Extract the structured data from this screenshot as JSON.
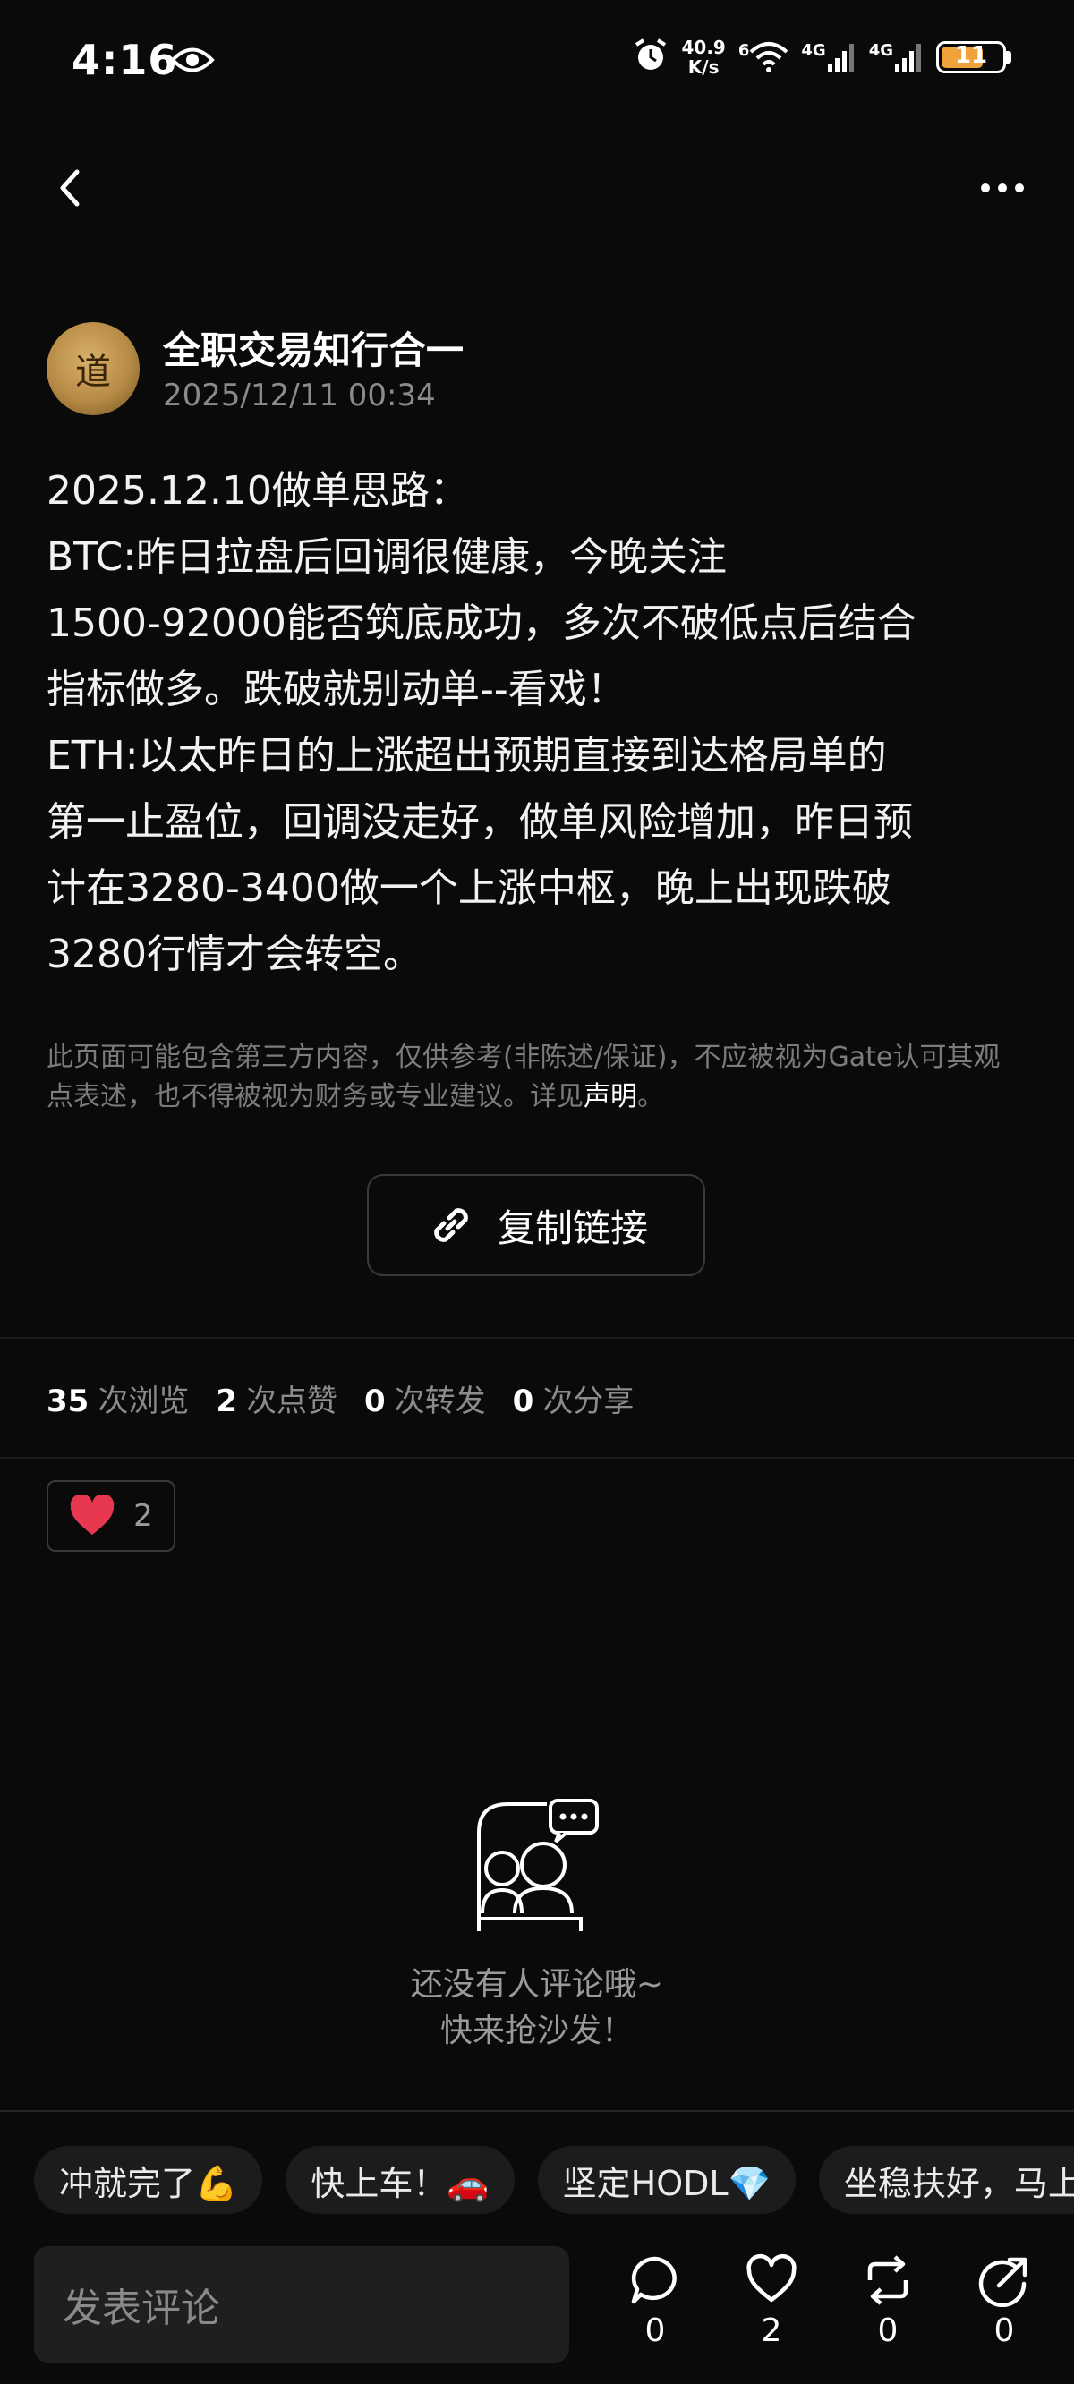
{
  "status_bar": {
    "time": "4:16",
    "net_speed_value": "40.9",
    "net_speed_unit": "K/s",
    "wifi_sup": "6",
    "sig1_label": "4G",
    "sig2_label": "4G",
    "battery": "11"
  },
  "author": {
    "avatar_char": "道",
    "name": "全职交易知行合一",
    "time": "2025/12/11 00:34"
  },
  "post": {
    "lines": [
      "2025.12.10做单思路：",
      "BTC:昨日拉盘后回调很健康，今晚关注",
      "1500-92000能否筑底成功，多次不破低点后结合",
      "指标做多。跌破就别动单--看戏！",
      "ETH:以太昨日的上涨超出预期直接到达格局单的",
      "第一止盈位，回调没走好，做单风险增加，昨日预",
      "计在3280-3400做一个上涨中枢，晚上出现跌破",
      "3280行情才会转空。"
    ]
  },
  "disclaimer": {
    "text": "此页面可能包含第三方内容，仅供参考(非陈述/保证)，不应被视为Gate认可其观点表述，也不得被视为财务或专业建议。详见",
    "link": "声明",
    "end": "。"
  },
  "copy_link": {
    "label": "复制链接"
  },
  "stats": [
    {
      "value": "35",
      "label": "次浏览"
    },
    {
      "value": "2",
      "label": "次点赞"
    },
    {
      "value": "0",
      "label": "次转发"
    },
    {
      "value": "0",
      "label": "次分享"
    }
  ],
  "reaction": {
    "count": "2"
  },
  "empty_state": {
    "line1": "还没有人评论哦~",
    "line2": "快来抢沙发！"
  },
  "quick_replies": [
    "冲就完了💪",
    "快上车！🚗",
    "坚定HODL💎",
    "坐稳扶好，马上"
  ],
  "comment_input": {
    "placeholder": "发表评论"
  },
  "actions": {
    "comments": "0",
    "likes": "2",
    "reposts": "0",
    "shares": "0"
  },
  "colors": {
    "background": "#0a0a0a",
    "like_red": "#e8384f",
    "battery": "#f0a33a"
  }
}
